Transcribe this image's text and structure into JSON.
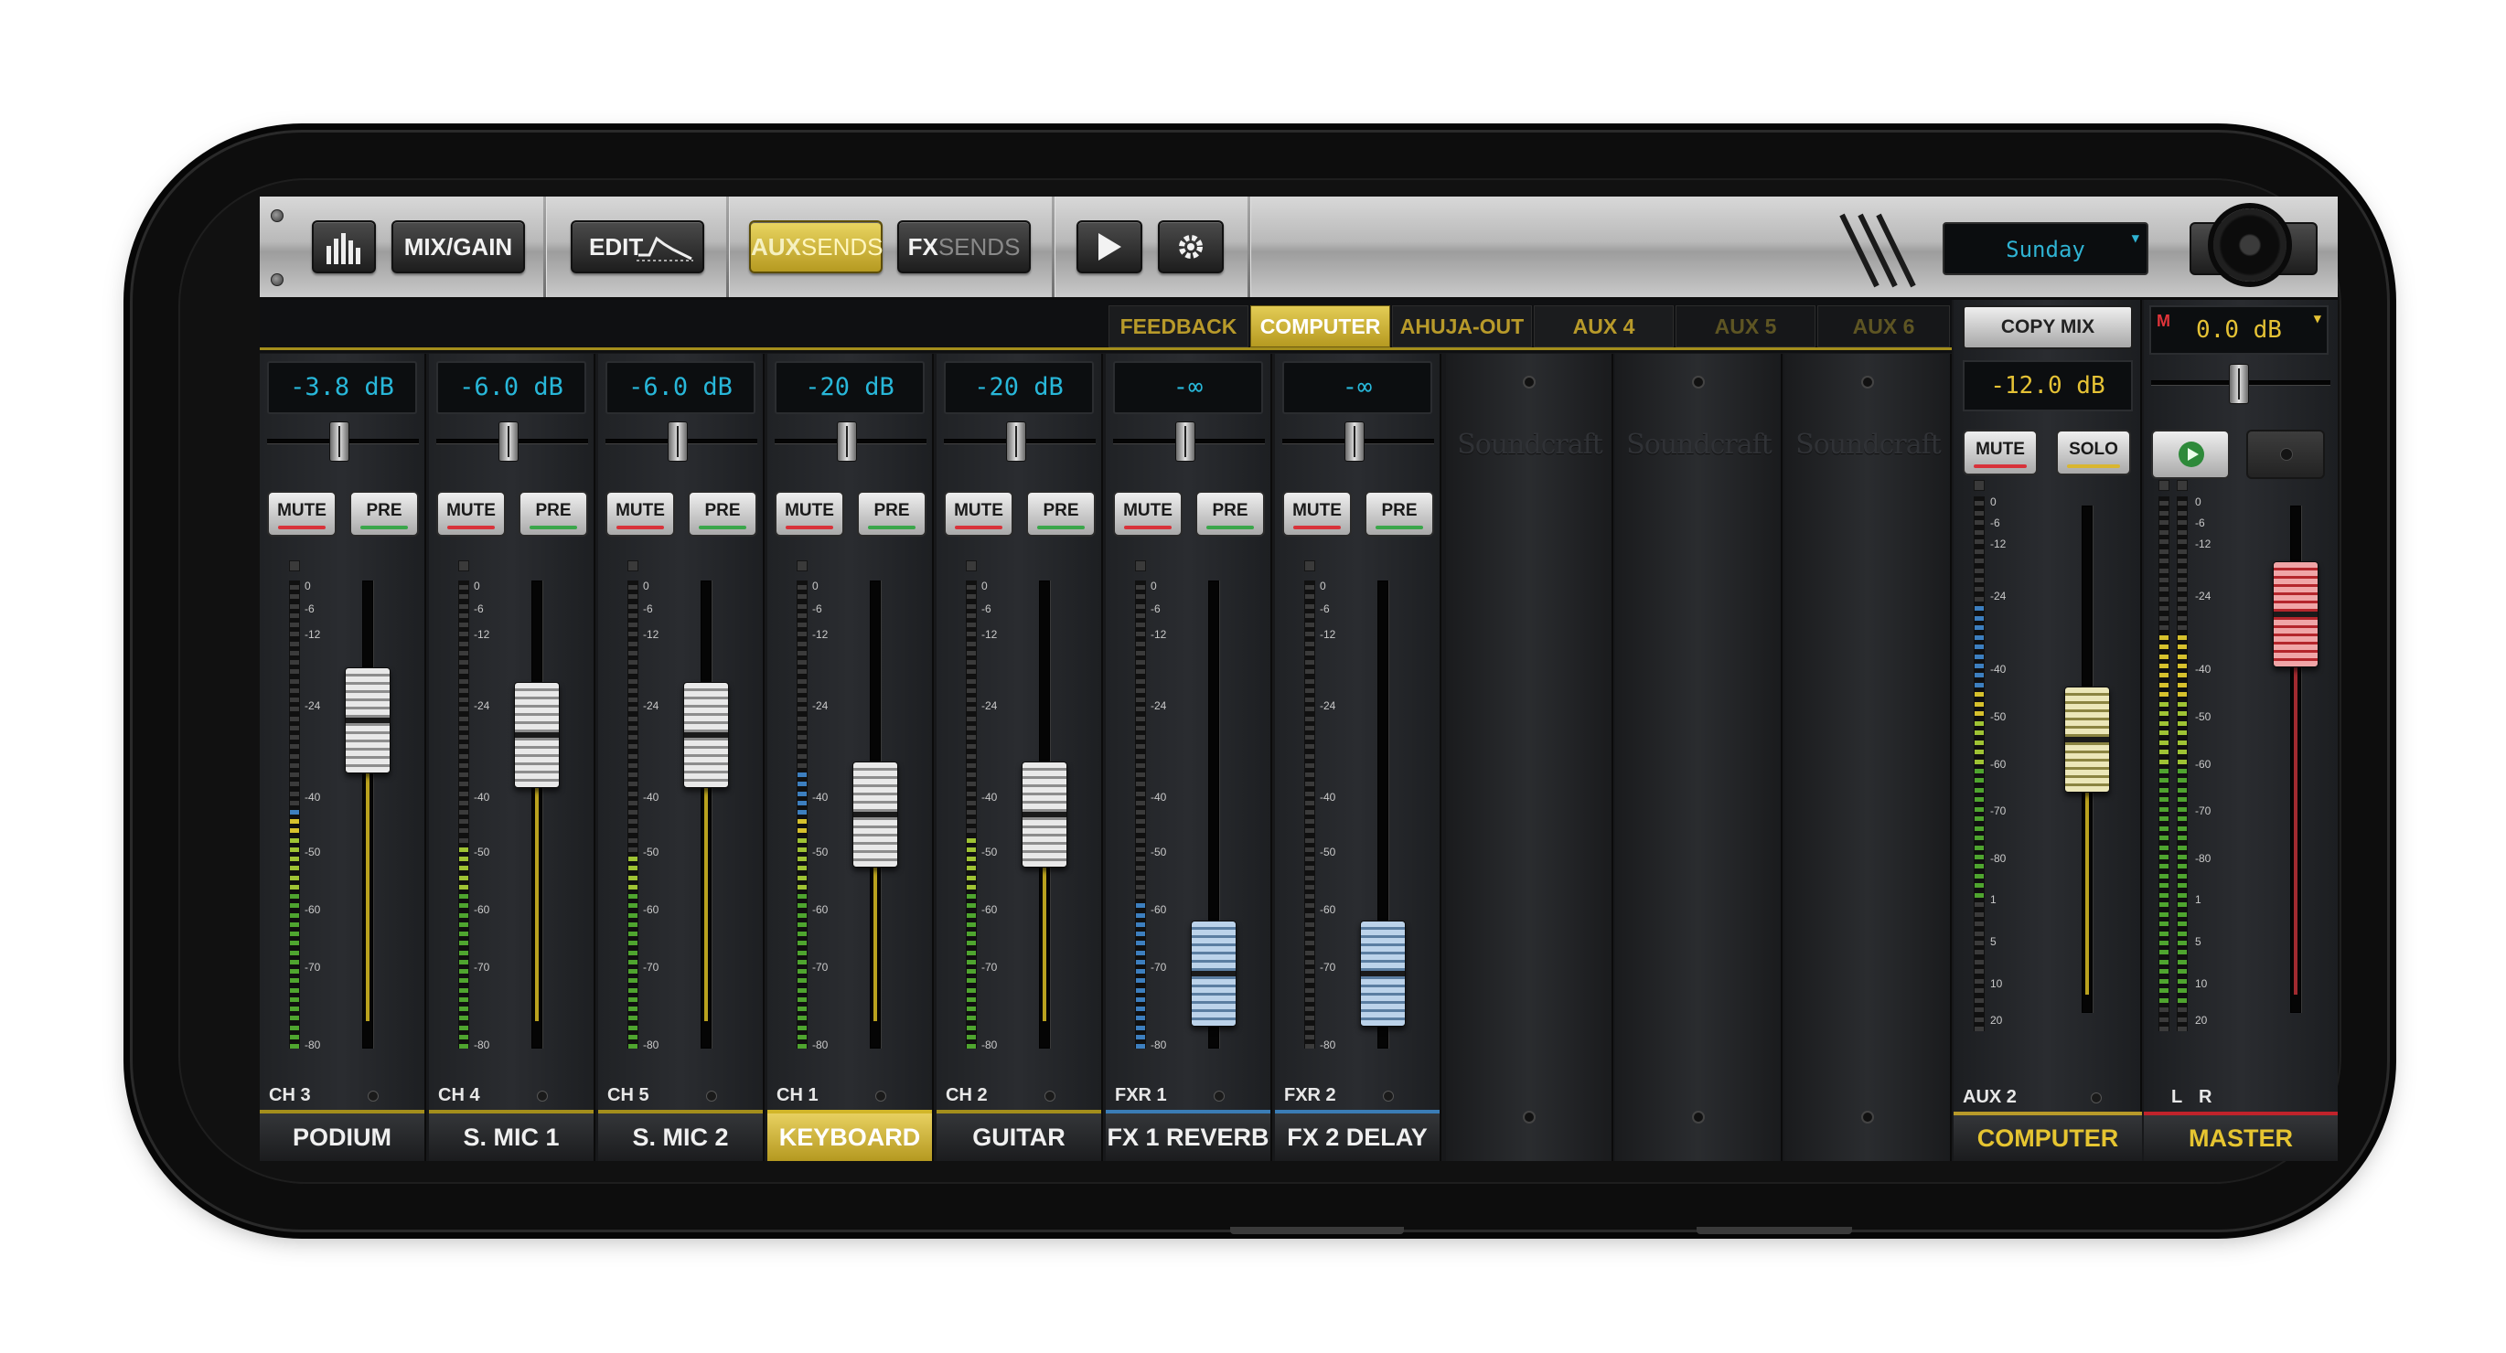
{
  "toolbar": {
    "mix_gain": "MIX/GAIN",
    "edit": "EDIT",
    "aux_sends": {
      "prefix": "AUX",
      "suffix": "SENDS"
    },
    "fx_sends": {
      "prefix": "FX",
      "suffix": "SENDS"
    },
    "show_name": "Sunday",
    "icons": [
      "meters-icon",
      "eq-curve-icon",
      "play-icon",
      "gear-icon",
      "brand-slash-logo"
    ]
  },
  "aux_tabs": [
    {
      "label": "FEEDBACK",
      "state": "normal"
    },
    {
      "label": "COMPUTER",
      "state": "active"
    },
    {
      "label": "AHUJA-OUT",
      "state": "normal"
    },
    {
      "label": "AUX 4",
      "state": "normal"
    },
    {
      "label": "AUX 5",
      "state": "dim"
    },
    {
      "label": "AUX 6",
      "state": "dim"
    }
  ],
  "buttons": {
    "mute": "MUTE",
    "pre": "PRE",
    "solo": "SOLO",
    "copy_mix": "COPY MIX"
  },
  "channels": [
    {
      "id": "CH 3",
      "name": "PODIUM",
      "level": "-3.8 dB",
      "fader": 0.76,
      "cap": "gray",
      "meter": 0.52,
      "selected": false
    },
    {
      "id": "CH 4",
      "name": "S. MIC 1",
      "level": "-6.0 dB",
      "fader": 0.72,
      "cap": "gray",
      "meter": 0.44,
      "selected": false
    },
    {
      "id": "CH 5",
      "name": "S. MIC 2",
      "level": "-6.0 dB",
      "fader": 0.72,
      "cap": "gray",
      "meter": 0.42,
      "selected": false
    },
    {
      "id": "CH 1",
      "name": "KEYBOARD",
      "level": "-20 dB",
      "fader": 0.5,
      "cap": "gray",
      "meter": 0.6,
      "selected": true
    },
    {
      "id": "CH 2",
      "name": "GUITAR",
      "level": "-20 dB",
      "fader": 0.5,
      "cap": "gray",
      "meter": 0.46,
      "selected": false
    },
    {
      "id": "FXR 1",
      "name": "FX 1 REVERB",
      "level": "-∞",
      "fader": 0.06,
      "cap": "blue",
      "meter": 0.32,
      "selected": false
    },
    {
      "id": "FXR 2",
      "name": "FX 2 DELAY",
      "level": "-∞",
      "fader": 0.06,
      "cap": "blue",
      "meter": 0.0,
      "selected": false
    }
  ],
  "meter_scale": [
    "0",
    "-6",
    "-12",
    "-24",
    "-40",
    "-50",
    "-60",
    "-70",
    "-80"
  ],
  "empty_brand": "Soundcraft",
  "aux_master": {
    "id": "AUX 2",
    "name": "COMPUTER",
    "level": "-12.0 dB",
    "fader": 0.55,
    "meter": 0.55
  },
  "aux_scale": [
    "0",
    "-6",
    "-12",
    "-24",
    "-40",
    "-50",
    "-60",
    "-70",
    "-80",
    "1",
    "5",
    "10",
    "20"
  ],
  "master": {
    "name": "MASTER",
    "level": "0.0 dB",
    "indicator": "M",
    "left": "L",
    "right": "R",
    "fader": 0.86,
    "meter_l": 0.75,
    "meter_r": 0.75
  },
  "colors": {
    "accent_gold": "#c8ad2c",
    "display_cyan": "#28b7d9",
    "display_amber": "#e5c235",
    "mute_red": "#d8323a",
    "pre_green": "#3aa64a"
  }
}
